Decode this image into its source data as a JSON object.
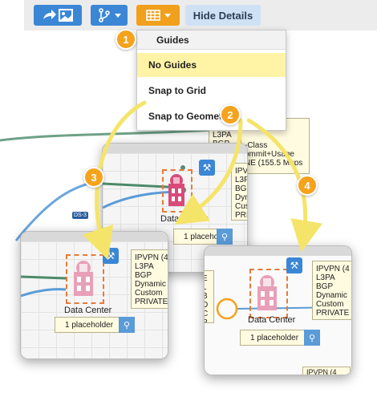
{
  "toolbar": {
    "hide_details_label": "Hide Details",
    "icons": [
      "share-image-icon",
      "branch-icon",
      "grid-icon"
    ]
  },
  "guides_menu": {
    "header": "Guides",
    "items": [
      {
        "label": "No Guides",
        "selected": true
      },
      {
        "label": "Snap to Grid",
        "selected": false
      },
      {
        "label": "Snap to Geometry",
        "selected": false
      }
    ]
  },
  "callouts": [
    "1",
    "2",
    "3",
    "4"
  ],
  "diagram": {
    "node_label": "Data Center",
    "placeholder": "1 placeholder",
    "ds_label": "DS-3",
    "info_back": [
      "-Class",
      "ommit+Usage",
      "NE (155.5 Mbps"
    ],
    "info_left": [
      "L3PA",
      "BGP"
    ],
    "info_mid": [
      "IPVPN",
      "L3PA",
      "BGP",
      "Dyna",
      "Custo",
      "PRIVA"
    ],
    "info_panel": [
      "IPVPN (4",
      "L3PA",
      "BGP",
      "Dynamic",
      "Custom",
      "PRIVATE"
    ],
    "info_left_cut": [
      "E",
      "L",
      "B",
      "D",
      "C",
      "P"
    ],
    "info_bottom_cut": "IPVPN (4"
  },
  "colors": {
    "accent_blue": "#3b87d6",
    "accent_orange": "#f5a21c",
    "selected_item": "#fff3a6",
    "note_fill": "#fffbe0",
    "connector_green": "#4a8a6a",
    "connector_blue": "#5a9bd8"
  }
}
